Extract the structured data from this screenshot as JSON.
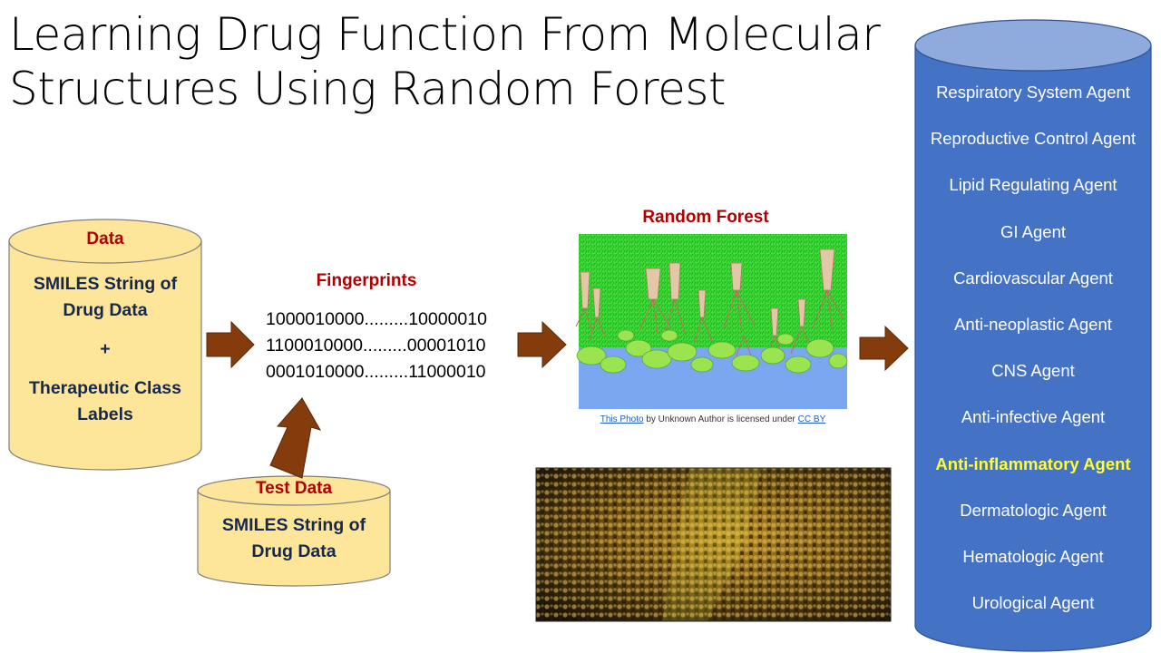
{
  "title": {
    "line1": "Learning Drug Function From Molecular",
    "line2": "Structures Using Random Forest"
  },
  "data_cylinder": {
    "heading": "Data",
    "line1": "SMILES String of",
    "line2": "Drug Data",
    "plus": "+",
    "line3": "Therapeutic Class",
    "line4": "Labels"
  },
  "test_cylinder": {
    "heading": "Test Data",
    "line1": "SMILES String of",
    "line2": "Drug Data"
  },
  "fingerprints": {
    "heading": "Fingerprints",
    "rows": [
      "1000010000.........10000010",
      "1100010000.........00001010",
      "0001010000.........11000010"
    ]
  },
  "random_forest": {
    "heading": "Random Forest",
    "caption_link1": "This Photo",
    "caption_mid": " by Unknown Author is licensed under ",
    "caption_link2": "CC BY"
  },
  "classes": {
    "items": [
      "Respiratory  System Agent",
      "Reproductive  Control Agent",
      "Lipid Regulating Agent",
      "GI Agent",
      "Cardiovascular  Agent",
      "Anti-neoplastic  Agent",
      "CNS Agent",
      "Anti-infective  Agent",
      "Anti-inflammatory  Agent",
      "Dermatologic Agent",
      "Hematologic Agent",
      "Urological Agent"
    ],
    "highlighted": "Anti-inflammatory  Agent"
  },
  "colors": {
    "cylinder_fill": "#fde59a",
    "cylinder_stroke": "#7f7f7f",
    "arrow_fill": "#843c0c",
    "class_cylinder": "#4472c4",
    "class_cylinder_top": "#8faadc",
    "heading_red": "#b00000",
    "cylinder_text": "#17284f",
    "highlight_yellow": "#ffff33"
  }
}
